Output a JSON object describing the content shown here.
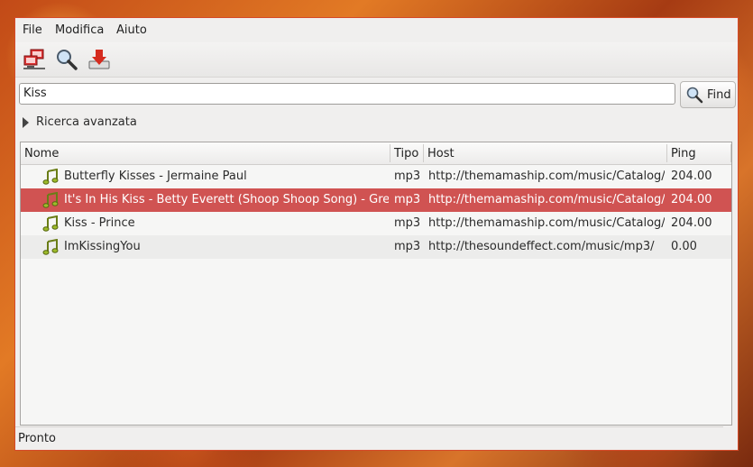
{
  "menu": {
    "file": "File",
    "edit": "Modifica",
    "help": "Aiuto"
  },
  "toolbar": {
    "icons": [
      "network-icon",
      "search-icon",
      "download-icon"
    ]
  },
  "search": {
    "value": "Kiss",
    "button_label": "Find"
  },
  "advanced_label": "Ricerca avanzata",
  "columns": {
    "name": "Nome",
    "type": "Tipo",
    "host": "Host",
    "ping": "Ping"
  },
  "rows": [
    {
      "name": "Butterfly Kisses - Jermaine Paul",
      "type": "mp3",
      "host": "http://themamaship.com/music/Catalog/",
      "ping": "204.00"
    },
    {
      "name": "It's In His Kiss - Betty Everett (Shoop Shoop Song) - Gre",
      "type": "mp3",
      "host": "http://themamaship.com/music/Catalog/",
      "ping": "204.00",
      "selected": true
    },
    {
      "name": "Kiss - Prince",
      "type": "mp3",
      "host": "http://themamaship.com/music/Catalog/",
      "ping": "204.00"
    },
    {
      "name": "ImKissingYou",
      "type": "mp3",
      "host": "http://thesoundeffect.com/music/mp3/",
      "ping": "0.00"
    }
  ],
  "status": "Pronto",
  "colors": {
    "selection": "#d05352",
    "window_border": "#d64a2a"
  }
}
